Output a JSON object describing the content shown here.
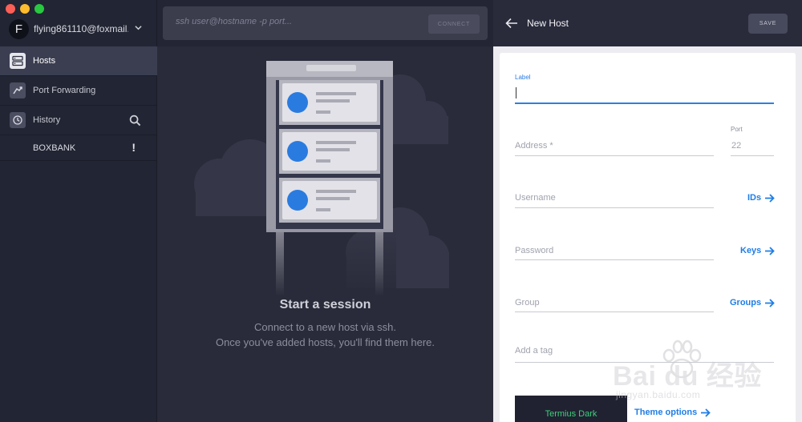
{
  "window": {
    "traffic_lights": [
      "close",
      "minimize",
      "zoom"
    ],
    "colors": {
      "close": "#fc5f57",
      "minimize": "#fdbc2e",
      "zoom": "#28c840"
    }
  },
  "sidebar": {
    "account": {
      "avatar_letter": "F",
      "email": "flying861110@foxmail.c..."
    },
    "nav": [
      {
        "label": "Hosts",
        "icon": "hosts-icon",
        "active": true
      },
      {
        "label": "Port Forwarding",
        "icon": "port-forwarding-icon",
        "active": false
      },
      {
        "label": "History",
        "icon": "history-icon",
        "active": false
      }
    ],
    "hosts": [
      {
        "label": "BOXBANK",
        "badge": "!"
      }
    ]
  },
  "main": {
    "ssh": {
      "placeholder": "ssh user@hostname -p port...",
      "connect_label": "CONNECT"
    },
    "empty_state": {
      "title": "Start a session",
      "line1": "Connect to a new host via ssh.",
      "line2": "Once you've added hosts, you'll find them here."
    }
  },
  "panel": {
    "title": "New Host",
    "save_label": "SAVE",
    "fields": {
      "label": {
        "label": "Label",
        "value": ""
      },
      "address": {
        "placeholder": "Address *"
      },
      "port": {
        "label": "Port",
        "value": "22"
      },
      "username": {
        "placeholder": "Username",
        "action": "IDs"
      },
      "password": {
        "placeholder": "Password",
        "action": "Keys"
      },
      "group": {
        "placeholder": "Group",
        "action": "Groups"
      },
      "tag": {
        "placeholder": "Add a tag"
      }
    },
    "theme": {
      "name": "Termius Dark",
      "options_label": "Theme options"
    }
  },
  "watermark": {
    "brand": "Bai du 经验",
    "url": "jingyan.baidu.com"
  },
  "colors": {
    "accent": "#2a7be0",
    "theme_name": "#3ed07a",
    "sidebar_bg": "#222533",
    "main_bg": "#292b3a"
  }
}
